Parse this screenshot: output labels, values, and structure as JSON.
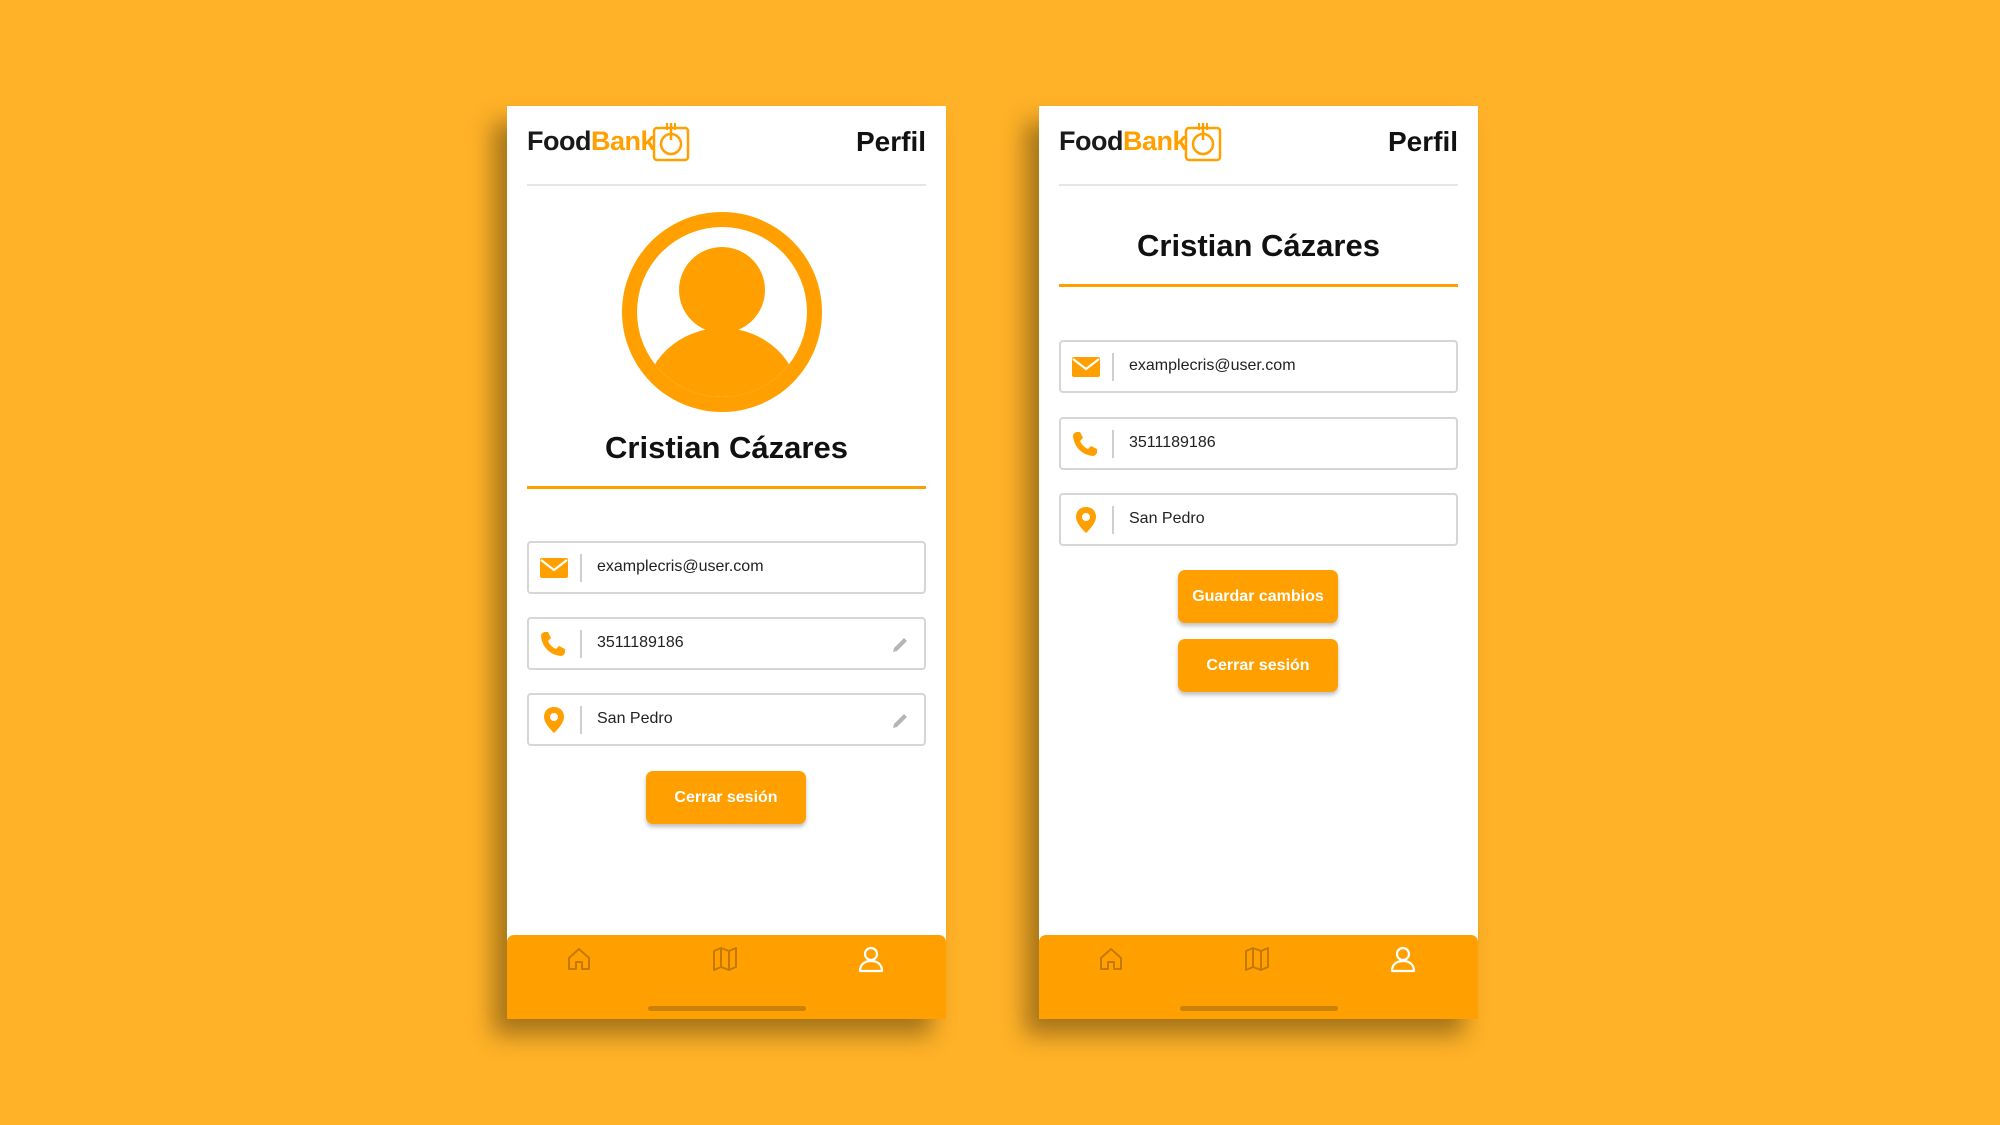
{
  "accent_color": "#FFA000",
  "background_color": "#FFB227",
  "screens": [
    {
      "logo": {
        "food": "Food",
        "bank": "Bank"
      },
      "title": "Perfil",
      "user_name": "Cristian Cázares",
      "fields": {
        "email": "examplecris@user.com",
        "phone": "3511189186",
        "location": "San Pedro"
      },
      "buttons": {
        "logout": "Cerrar sesión"
      },
      "nav": [
        "home-icon",
        "map-icon",
        "user-icon"
      ]
    },
    {
      "logo": {
        "food": "Food",
        "bank": "Bank"
      },
      "title": "Perfil",
      "user_name": "Cristian Cázares",
      "fields": {
        "email": "examplecris@user.com",
        "phone": "3511189186",
        "location": "San Pedro"
      },
      "buttons": {
        "save": "Guardar cambios",
        "logout": "Cerrar sesión"
      },
      "nav": [
        "home-icon",
        "map-icon",
        "user-icon"
      ]
    }
  ]
}
